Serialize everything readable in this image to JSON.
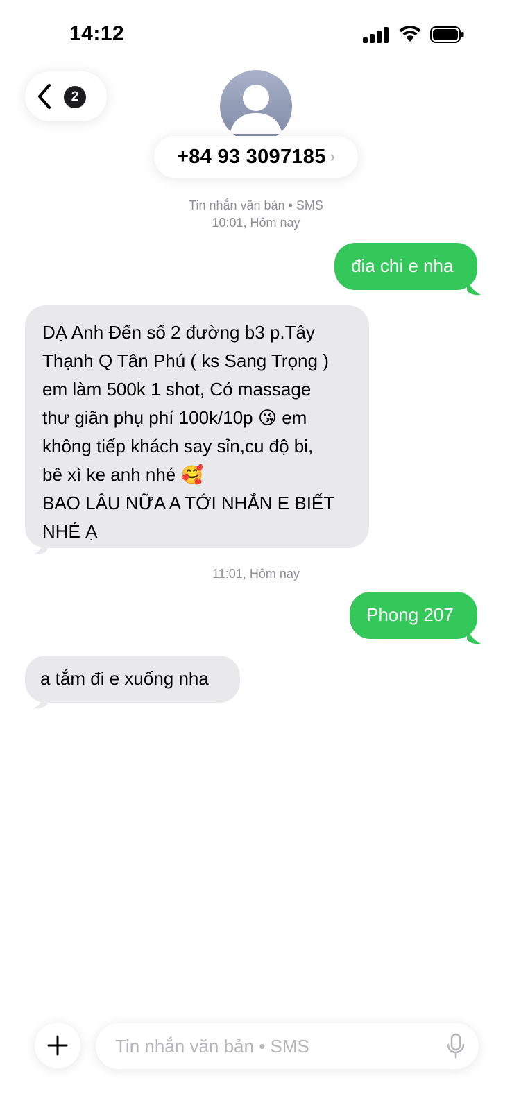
{
  "status_bar": {
    "time": "14:12"
  },
  "header": {
    "back_badge": "2",
    "contact": "+84 93 3097185",
    "contact_chevron": "›"
  },
  "conversation": {
    "meta1_line1": "Tin nhắn văn bản • SMS",
    "meta1_line2": "10:01, Hôm nay",
    "meta2": "11:01, Hôm nay",
    "messages": [
      {
        "direction": "out",
        "lines": [
          "đia chi e nha"
        ]
      },
      {
        "direction": "in",
        "lines": [
          "DẠ Anh Đến số 2 đường b3 p.Tây",
          "Thạnh Q Tân Phú ( ks Sang Trọng )",
          "em làm 500k 1 shot, Có massage",
          "thư giãn phụ phí 100k/10p 😘 em",
          "không tiếp khách say sỉn,cu độ bi,",
          "bê xì ke anh nhé 🥰",
          "BAO LÂU NỮA A TỚI NHẮN E BIẾT",
          "NHÉ Ạ"
        ]
      },
      {
        "direction": "out",
        "lines": [
          "Phong 207"
        ]
      },
      {
        "direction": "in",
        "lines": [
          "a tắm đi e xuống nha"
        ]
      }
    ]
  },
  "input": {
    "placeholder": "Tin nhắn văn bản • SMS"
  },
  "icons": {
    "back": "chevron-left-icon",
    "signal": "cellular-signal-icon",
    "wifi": "wifi-icon",
    "battery": "battery-icon",
    "plus": "plus-icon",
    "mic": "microphone-icon"
  },
  "colors": {
    "outgoing_bubble": "#34c759",
    "incoming_bubble": "#e9e9eb",
    "meta_text": "#8e8e93",
    "placeholder": "#b6b6ba"
  }
}
